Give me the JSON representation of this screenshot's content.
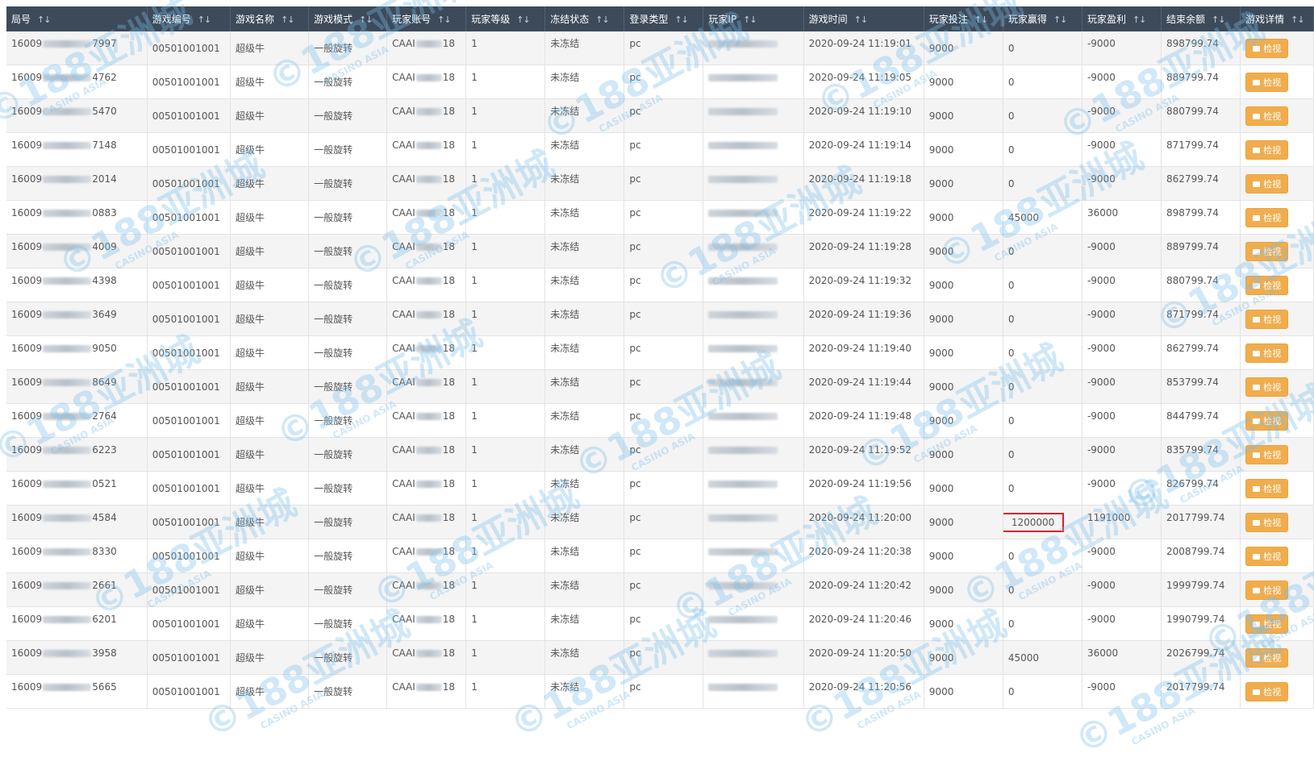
{
  "headers": [
    "局号",
    "游戏编号",
    "游戏名称",
    "游戏模式",
    "玩家账号",
    "玩家等级",
    "冻结状态",
    "登录类型",
    "玩家IP",
    "游戏时间",
    "玩家投注",
    "玩家赢得",
    "玩家盈利",
    "结束余额",
    "游戏详情"
  ],
  "sort_icon": "↑↓",
  "detail_label": "检视",
  "rows": [
    {
      "id_prefix": "16009",
      "id_suffix": "7997",
      "game_no": "00501001001",
      "game_name": "超级牛",
      "mode": "一般旋转",
      "acct_prefix": "CAAI",
      "acct_suffix": "18",
      "level": "1",
      "freeze": "未冻结",
      "login": "pc",
      "time": "2020-09-24 11:19:01",
      "bet": "9000",
      "win": "0",
      "profit": "-9000",
      "balance": "898799.74"
    },
    {
      "id_prefix": "16009",
      "id_suffix": "4762",
      "game_no": "00501001001",
      "game_name": "超级牛",
      "mode": "一般旋转",
      "acct_prefix": "CAAI",
      "acct_suffix": "18",
      "level": "1",
      "freeze": "未冻结",
      "login": "pc",
      "time": "2020-09-24 11:19:05",
      "bet": "9000",
      "win": "0",
      "profit": "-9000",
      "balance": "889799.74"
    },
    {
      "id_prefix": "16009",
      "id_suffix": "5470",
      "game_no": "00501001001",
      "game_name": "超级牛",
      "mode": "一般旋转",
      "acct_prefix": "CAAI",
      "acct_suffix": "18",
      "level": "1",
      "freeze": "未冻结",
      "login": "pc",
      "time": "2020-09-24 11:19:10",
      "bet": "9000",
      "win": "0",
      "profit": "-9000",
      "balance": "880799.74"
    },
    {
      "id_prefix": "16009",
      "id_suffix": "7148",
      "game_no": "00501001001",
      "game_name": "超级牛",
      "mode": "一般旋转",
      "acct_prefix": "CAAI",
      "acct_suffix": "18",
      "level": "1",
      "freeze": "未冻结",
      "login": "pc",
      "time": "2020-09-24 11:19:14",
      "bet": "9000",
      "win": "0",
      "profit": "-9000",
      "balance": "871799.74"
    },
    {
      "id_prefix": "16009",
      "id_suffix": "2014",
      "game_no": "00501001001",
      "game_name": "超级牛",
      "mode": "一般旋转",
      "acct_prefix": "CAAI",
      "acct_suffix": "18",
      "level": "1",
      "freeze": "未冻结",
      "login": "pc",
      "time": "2020-09-24 11:19:18",
      "bet": "9000",
      "win": "0",
      "profit": "-9000",
      "balance": "862799.74"
    },
    {
      "id_prefix": "16009",
      "id_suffix": "0883",
      "game_no": "00501001001",
      "game_name": "超级牛",
      "mode": "一般旋转",
      "acct_prefix": "CAAI",
      "acct_suffix": "18",
      "level": "1",
      "freeze": "未冻结",
      "login": "pc",
      "time": "2020-09-24 11:19:22",
      "bet": "9000",
      "win": "45000",
      "profit": "36000",
      "balance": "898799.74"
    },
    {
      "id_prefix": "16009",
      "id_suffix": "4009",
      "game_no": "00501001001",
      "game_name": "超级牛",
      "mode": "一般旋转",
      "acct_prefix": "CAAI",
      "acct_suffix": "18",
      "level": "1",
      "freeze": "未冻结",
      "login": "pc",
      "time": "2020-09-24 11:19:28",
      "bet": "9000",
      "win": "0",
      "profit": "-9000",
      "balance": "889799.74"
    },
    {
      "id_prefix": "16009",
      "id_suffix": "4398",
      "game_no": "00501001001",
      "game_name": "超级牛",
      "mode": "一般旋转",
      "acct_prefix": "CAAI",
      "acct_suffix": "18",
      "level": "1",
      "freeze": "未冻结",
      "login": "pc",
      "time": "2020-09-24 11:19:32",
      "bet": "9000",
      "win": "0",
      "profit": "-9000",
      "balance": "880799.74"
    },
    {
      "id_prefix": "16009",
      "id_suffix": "3649",
      "game_no": "00501001001",
      "game_name": "超级牛",
      "mode": "一般旋转",
      "acct_prefix": "CAAI",
      "acct_suffix": "18",
      "level": "1",
      "freeze": "未冻结",
      "login": "pc",
      "time": "2020-09-24 11:19:36",
      "bet": "9000",
      "win": "0",
      "profit": "-9000",
      "balance": "871799.74"
    },
    {
      "id_prefix": "16009",
      "id_suffix": "9050",
      "game_no": "00501001001",
      "game_name": "超级牛",
      "mode": "一般旋转",
      "acct_prefix": "CAAI",
      "acct_suffix": "18",
      "level": "1",
      "freeze": "未冻结",
      "login": "pc",
      "time": "2020-09-24 11:19:40",
      "bet": "9000",
      "win": "0",
      "profit": "-9000",
      "balance": "862799.74"
    },
    {
      "id_prefix": "16009",
      "id_suffix": "8649",
      "game_no": "00501001001",
      "game_name": "超级牛",
      "mode": "一般旋转",
      "acct_prefix": "CAAI",
      "acct_suffix": "18",
      "level": "1",
      "freeze": "未冻结",
      "login": "pc",
      "time": "2020-09-24 11:19:44",
      "bet": "9000",
      "win": "0",
      "profit": "-9000",
      "balance": "853799.74"
    },
    {
      "id_prefix": "16009",
      "id_suffix": "2764",
      "game_no": "00501001001",
      "game_name": "超级牛",
      "mode": "一般旋转",
      "acct_prefix": "CAAI",
      "acct_suffix": "18",
      "level": "1",
      "freeze": "未冻结",
      "login": "pc",
      "time": "2020-09-24 11:19:48",
      "bet": "9000",
      "win": "0",
      "profit": "-9000",
      "balance": "844799.74"
    },
    {
      "id_prefix": "16009",
      "id_suffix": "6223",
      "game_no": "00501001001",
      "game_name": "超级牛",
      "mode": "一般旋转",
      "acct_prefix": "CAAI",
      "acct_suffix": "18",
      "level": "1",
      "freeze": "未冻结",
      "login": "pc",
      "time": "2020-09-24 11:19:52",
      "bet": "9000",
      "win": "0",
      "profit": "-9000",
      "balance": "835799.74"
    },
    {
      "id_prefix": "16009",
      "id_suffix": "0521",
      "game_no": "00501001001",
      "game_name": "超级牛",
      "mode": "一般旋转",
      "acct_prefix": "CAAI",
      "acct_suffix": "18",
      "level": "1",
      "freeze": "未冻结",
      "login": "pc",
      "time": "2020-09-24 11:19:56",
      "bet": "9000",
      "win": "0",
      "profit": "-9000",
      "balance": "826799.74"
    },
    {
      "id_prefix": "16009",
      "id_suffix": "4584",
      "game_no": "00501001001",
      "game_name": "超级牛",
      "mode": "一般旋转",
      "acct_prefix": "CAAI",
      "acct_suffix": "18",
      "level": "1",
      "freeze": "未冻结",
      "login": "pc",
      "time": "2020-09-24 11:20:00",
      "bet": "9000",
      "win": "1200000",
      "profit": "1191000",
      "balance": "2017799.74",
      "highlight_win": true
    },
    {
      "id_prefix": "16009",
      "id_suffix": "8330",
      "game_no": "00501001001",
      "game_name": "超级牛",
      "mode": "一般旋转",
      "acct_prefix": "CAAI",
      "acct_suffix": "18",
      "level": "1",
      "freeze": "未冻结",
      "login": "pc",
      "time": "2020-09-24 11:20:38",
      "bet": "9000",
      "win": "0",
      "profit": "-9000",
      "balance": "2008799.74"
    },
    {
      "id_prefix": "16009",
      "id_suffix": "2661",
      "game_no": "00501001001",
      "game_name": "超级牛",
      "mode": "一般旋转",
      "acct_prefix": "CAAI",
      "acct_suffix": "18",
      "level": "1",
      "freeze": "未冻结",
      "login": "pc",
      "time": "2020-09-24 11:20:42",
      "bet": "9000",
      "win": "0",
      "profit": "-9000",
      "balance": "1999799.74"
    },
    {
      "id_prefix": "16009",
      "id_suffix": "6201",
      "game_no": "00501001001",
      "game_name": "超级牛",
      "mode": "一般旋转",
      "acct_prefix": "CAAI",
      "acct_suffix": "18",
      "level": "1",
      "freeze": "未冻结",
      "login": "pc",
      "time": "2020-09-24 11:20:46",
      "bet": "9000",
      "win": "0",
      "profit": "-9000",
      "balance": "1990799.74"
    },
    {
      "id_prefix": "16009",
      "id_suffix": "3958",
      "game_no": "00501001001",
      "game_name": "超级牛",
      "mode": "一般旋转",
      "acct_prefix": "CAAI",
      "acct_suffix": "18",
      "level": "1",
      "freeze": "未冻结",
      "login": "pc",
      "time": "2020-09-24 11:20:50",
      "bet": "9000",
      "win": "45000",
      "profit": "36000",
      "balance": "2026799.74"
    },
    {
      "id_prefix": "16009",
      "id_suffix": "5665",
      "game_no": "00501001001",
      "game_name": "超级牛",
      "mode": "一般旋转",
      "acct_prefix": "CAAI",
      "acct_suffix": "18",
      "level": "1",
      "freeze": "未冻结",
      "login": "pc",
      "time": "2020-09-24 11:20:56",
      "bet": "9000",
      "win": "0",
      "profit": "-9000",
      "balance": "2017799.74"
    }
  ],
  "watermark": {
    "text": "©188亚洲城",
    "sub": "CASINO ASIA"
  },
  "colors": {
    "header_bg": "#3c4a5a",
    "button": "#f0ad4e",
    "highlight_border": "#d9202a",
    "watermark": "#78beeb"
  }
}
